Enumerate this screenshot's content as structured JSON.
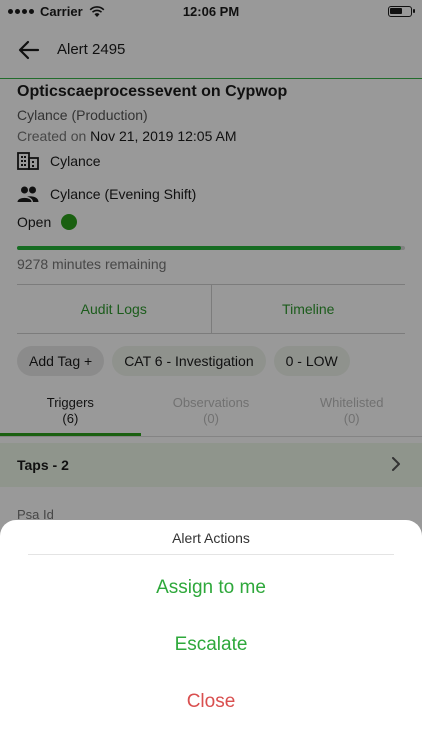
{
  "status_bar": {
    "carrier": "Carrier",
    "time": "12:06 PM"
  },
  "nav": {
    "title": "Alert 2495"
  },
  "alert": {
    "title": "Opticscaeprocessevent on Cypwop",
    "tenant": "Cylance (Production)",
    "created_label": "Created on",
    "created_value": "Nov 21, 2019 12:05 AM",
    "organization": "Cylance",
    "team": "Cylance (Evening Shift)",
    "status": "Open",
    "status_color": "#2ca01c",
    "progress_fraction": 0.99,
    "remaining": "9278 minutes remaining"
  },
  "tab_buttons": [
    "Audit Logs",
    "Timeline"
  ],
  "chips": {
    "add_tag": "Add Tag +",
    "category": "CAT 6 - Investigation",
    "severity": "0 - LOW"
  },
  "segments": [
    {
      "label": "Triggers",
      "count": "(6)"
    },
    {
      "label": "Observations",
      "count": "(0)"
    },
    {
      "label": "Whitelisted",
      "count": "(0)"
    }
  ],
  "taps": {
    "label": "Taps - 2"
  },
  "psa_label": "Psa Id",
  "sheet": {
    "title": "Alert Actions",
    "assign": "Assign to me",
    "escalate": "Escalate",
    "close": "Close"
  },
  "colors": {
    "accent": "#2ea83b",
    "danger": "#d94f4f"
  }
}
